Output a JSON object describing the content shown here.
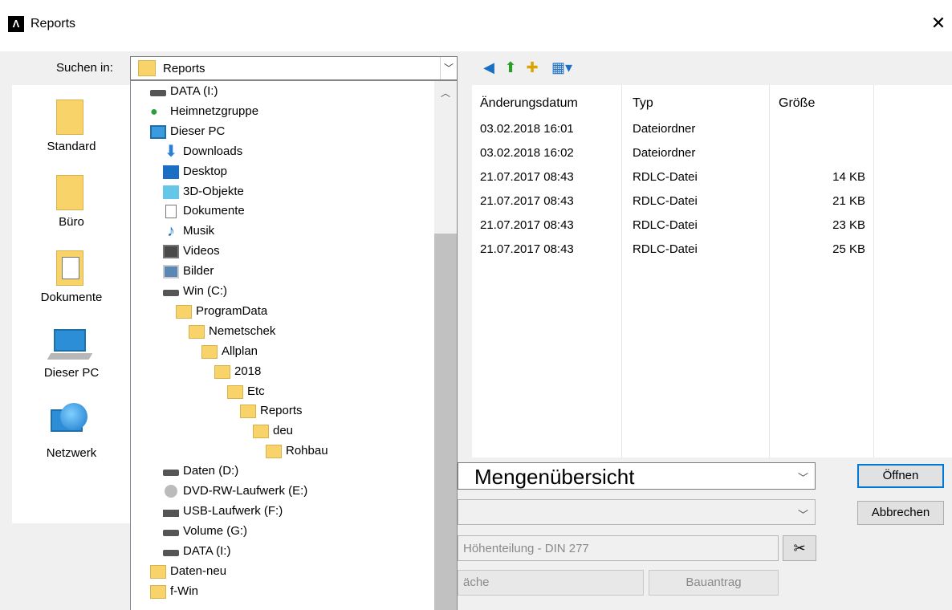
{
  "window": {
    "title": "Reports",
    "close_icon": "close-icon"
  },
  "lookin": {
    "label": "Suchen in:",
    "value": "Reports"
  },
  "places": [
    {
      "label": "Standard",
      "icon": "folder-icon"
    },
    {
      "label": "Büro",
      "icon": "folder-icon"
    },
    {
      "label": "Dokumente",
      "icon": "documents-folder-icon"
    },
    {
      "label": "Dieser PC",
      "icon": "computer-icon"
    },
    {
      "label": "Netzwerk",
      "icon": "network-icon"
    }
  ],
  "list": {
    "headers": {
      "date": "Änderungsdatum",
      "type": "Typ",
      "size": "Größe"
    },
    "rows": [
      {
        "date": "03.02.2018 16:01",
        "type": "Dateiordner",
        "size": ""
      },
      {
        "date": "03.02.2018 16:02",
        "type": "Dateiordner",
        "size": ""
      },
      {
        "date": "21.07.2017 08:43",
        "type": "RDLC-Datei",
        "size": "14 KB"
      },
      {
        "date": "21.07.2017 08:43",
        "type": "RDLC-Datei",
        "size": "21 KB"
      },
      {
        "date": "21.07.2017 08:43",
        "type": "RDLC-Datei",
        "size": "23 KB"
      },
      {
        "date": "21.07.2017 08:43",
        "type": "RDLC-Datei",
        "size": "25 KB"
      }
    ]
  },
  "filename": {
    "value": "Mengenübersicht"
  },
  "filetype": {
    "value": ""
  },
  "extra": {
    "value": "Höhenteilung - DIN 277"
  },
  "buttons": {
    "open": "Öffnen",
    "cancel": "Abbrechen",
    "left_gray": "äche",
    "bauantrag": "Bauantrag"
  },
  "dropdown": [
    {
      "label": "DATA (I:)",
      "icon": "drive",
      "level": 0
    },
    {
      "label": "Heimnetzgruppe",
      "icon": "network",
      "level": 0
    },
    {
      "label": "Dieser PC",
      "icon": "pc",
      "level": 0
    },
    {
      "label": "Downloads",
      "icon": "download",
      "level": 1
    },
    {
      "label": "Desktop",
      "icon": "desktop",
      "level": 1
    },
    {
      "label": "3D-Objekte",
      "icon": "3d",
      "level": 1
    },
    {
      "label": "Dokumente",
      "icon": "doc",
      "level": 1
    },
    {
      "label": "Musik",
      "icon": "music",
      "level": 1
    },
    {
      "label": "Videos",
      "icon": "video",
      "level": 1
    },
    {
      "label": "Bilder",
      "icon": "picture",
      "level": 1
    },
    {
      "label": "Win (C:)",
      "icon": "drive",
      "level": 1
    },
    {
      "label": "ProgramData",
      "icon": "folder",
      "level": 2
    },
    {
      "label": "Nemetschek",
      "icon": "folder",
      "level": 3
    },
    {
      "label": "Allplan",
      "icon": "folder",
      "level": 4
    },
    {
      "label": "2018",
      "icon": "folder",
      "level": 5
    },
    {
      "label": "Etc",
      "icon": "folder",
      "level": 6
    },
    {
      "label": "Reports",
      "icon": "folder",
      "level": 7
    },
    {
      "label": "deu",
      "icon": "folder",
      "level": 8
    },
    {
      "label": "Rohbau",
      "icon": "folder",
      "level": 9
    },
    {
      "label": "Daten (D:)",
      "icon": "drive",
      "level": 1
    },
    {
      "label": "DVD-RW-Laufwerk (E:)",
      "icon": "dvd",
      "level": 1
    },
    {
      "label": "USB-Laufwerk (F:)",
      "icon": "usb",
      "level": 1
    },
    {
      "label": "Volume (G:)",
      "icon": "drive",
      "level": 1
    },
    {
      "label": "DATA (I:)",
      "icon": "drive",
      "level": 1
    },
    {
      "label": "Daten-neu",
      "icon": "folder",
      "level": 0
    },
    {
      "label": "f-Win",
      "icon": "folder",
      "level": 0
    }
  ]
}
